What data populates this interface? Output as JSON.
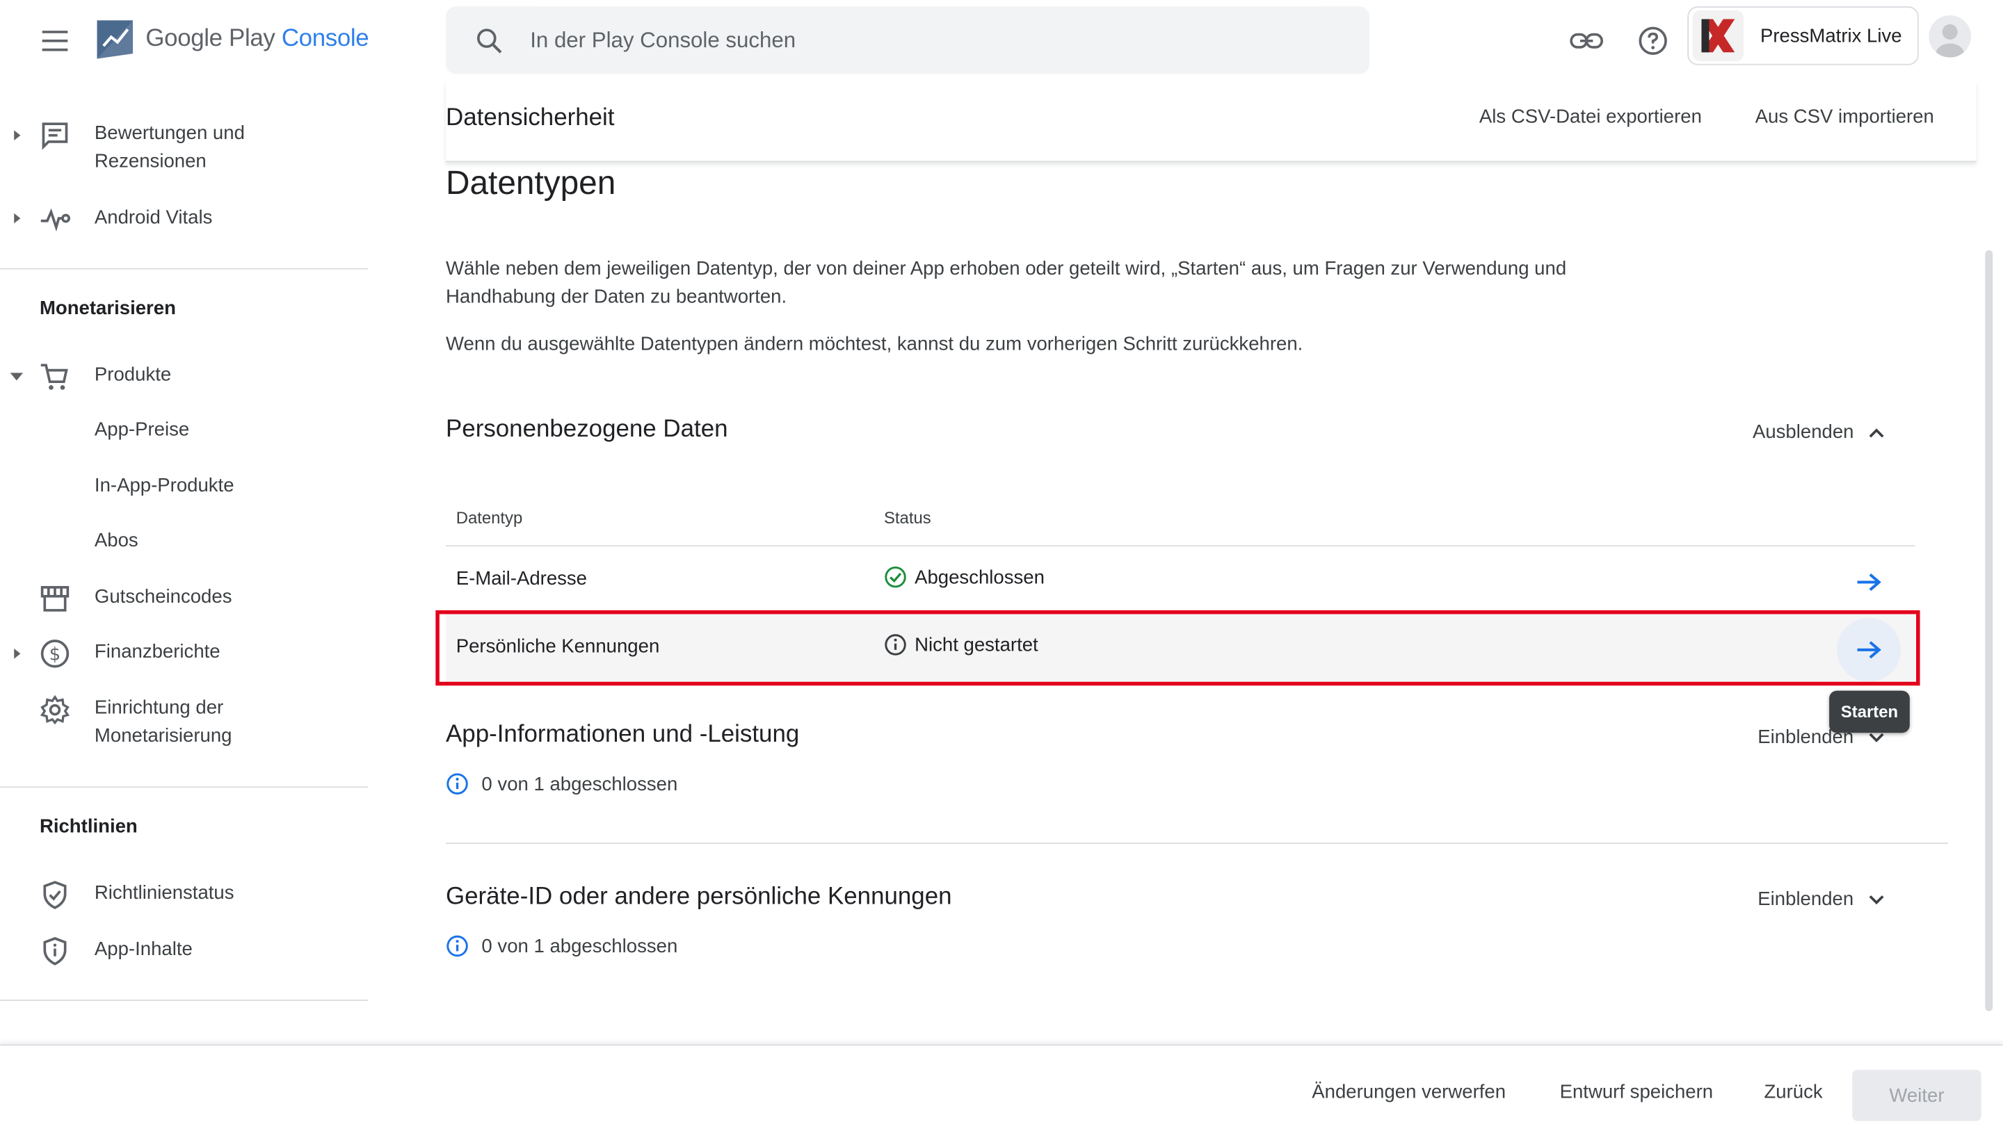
{
  "app": {
    "logo_text_1": "Google Play",
    "logo_text_2": "Console",
    "search_placeholder": "In der Play Console suchen",
    "account_name": "PressMatrix Live"
  },
  "sidebar": {
    "items": [
      {
        "label_1": "Bewertungen und",
        "label_2": "Rezensionen",
        "icon": "reviews-icon"
      },
      {
        "label": "Android Vitals",
        "icon": "vitals-icon"
      }
    ],
    "section_monetize": "Monetarisieren",
    "products": "Produkte",
    "sub_items": [
      "App-Preise",
      "In-App-Produkte",
      "Abos"
    ],
    "coupons": "Gutscheincodes",
    "finance": "Finanzberichte",
    "monetize_setup_1": "Einrichtung der",
    "monetize_setup_2": "Monetarisierung",
    "section_policy": "Richtlinien",
    "policy_status": "Richtlinienstatus",
    "app_content": "App-Inhalte"
  },
  "header": {
    "title": "Datensicherheit",
    "export_csv": "Als CSV-Datei exportieren",
    "import_csv": "Aus CSV importieren"
  },
  "content": {
    "heading": "Datentypen",
    "para1": "Wähle neben dem jeweiligen Datentyp, der von deiner App erhoben oder geteilt wird, „Starten“ aus, um Fragen zur Verwendung und Handhabung der Daten zu beantworten.",
    "para2": "Wenn du ausgewählte Datentypen ändern möchtest, kannst du zum vorherigen Schritt zurückkehren.",
    "sections": [
      {
        "title": "Personenbezogene Daten",
        "toggle": "Ausblenden",
        "table": {
          "col_type": "Datentyp",
          "col_status": "Status",
          "rows": [
            {
              "type": "E-Mail-Adresse",
              "status": "Abgeschlossen",
              "status_kind": "done"
            },
            {
              "type": "Persönliche Kennungen",
              "status": "Nicht gestartet",
              "status_kind": "info"
            }
          ]
        }
      },
      {
        "title": "App-Informationen und -Leistung",
        "toggle": "Einblenden",
        "progress": "0 von 1 abgeschlossen"
      },
      {
        "title": "Geräte-ID oder andere persönliche Kennungen",
        "toggle": "Einblenden",
        "progress": "0 von 1 abgeschlossen"
      }
    ],
    "tooltip": "Starten"
  },
  "footer": {
    "discard": "Änderungen verwerfen",
    "save_draft": "Entwurf speichern",
    "back": "Zurück",
    "next": "Weiter"
  },
  "colors": {
    "accent": "#1a73e8",
    "success": "#1e8e3e",
    "highlight": "#e3001b"
  }
}
